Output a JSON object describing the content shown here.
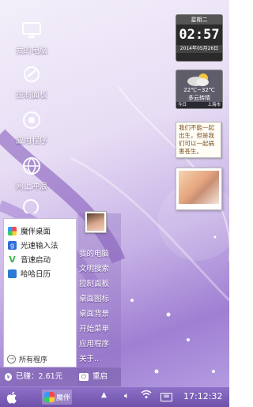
{
  "desktop_icons": [
    {
      "label": "我的电脑",
      "icon": "computer-icon"
    },
    {
      "label": "控制面板",
      "icon": "control-panel-icon"
    },
    {
      "label": "应用程序",
      "icon": "apps-icon"
    },
    {
      "label": "网上冲浪",
      "icon": "browser-icon"
    }
  ],
  "clock_widget": {
    "day": "星期二",
    "time": "02:57",
    "date": "2014年05月26日"
  },
  "weather_widget": {
    "temp": "22℃~32℃",
    "desc": "多云转晴",
    "today": "今日",
    "city": "上海市"
  },
  "note_widget": {
    "text": "我们不能一起出生，但是我们可以一起祸害苍生。"
  },
  "start_menu": {
    "pinned": [
      {
        "label": "魔伴桌面",
        "icon": "mobanwidget-icon",
        "color": "#e94b8a"
      },
      {
        "label": "光速输入法",
        "icon": "input-method-icon",
        "color": "#2e6fd6"
      },
      {
        "label": "音速启动",
        "icon": "launcher-icon",
        "color": "#3ab54a"
      },
      {
        "label": "哈哈日历",
        "icon": "calendar-icon",
        "color": "#2a7ad6"
      }
    ],
    "all_programs": "所有程序",
    "links": [
      "我的电脑",
      "文明搜索",
      "控制面板",
      "桌面图标",
      "桌面背景",
      "开始菜单",
      "应用程序",
      "关于.."
    ],
    "earned": "已赚：2.61元",
    "restart": "重启"
  },
  "taskbar": {
    "app_label": "魔伴",
    "clock": "17:12:32"
  }
}
